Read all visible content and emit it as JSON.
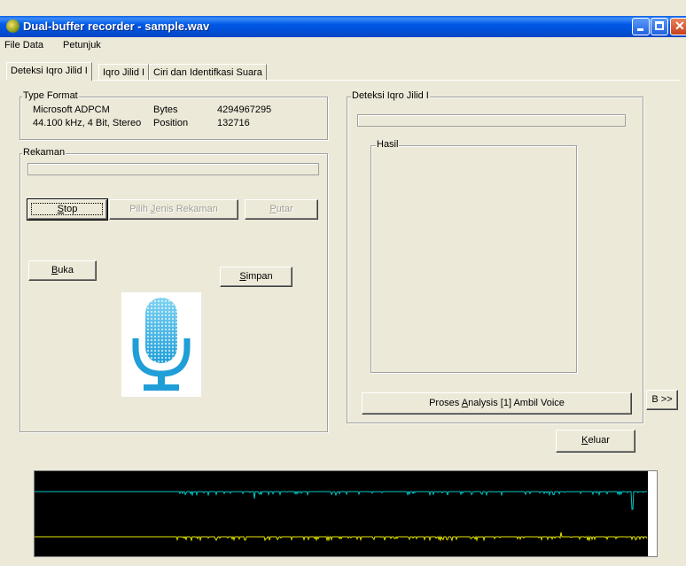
{
  "window": {
    "title": "Dual-buffer recorder - sample.wav"
  },
  "menu": {
    "items": [
      "File Data",
      "Petunjuk"
    ]
  },
  "tabs": [
    "Deteksi Iqro Jilid I",
    "Iqro Jilid I",
    "Ciri dan Identifkasi Suara"
  ],
  "type_format": {
    "label": "Type Format",
    "codec": "Microsoft ADPCM",
    "format": "44.100 kHz, 4 Bit, Stereo",
    "bytes_label": "Bytes",
    "bytes_value": "4294967295",
    "position_label": "Position",
    "position_value": "132716"
  },
  "rekaman": {
    "label": "Rekaman",
    "stop": {
      "accel": "S",
      "rest": "top"
    },
    "pilih": {
      "text": "Pilih ",
      "accel": "J",
      "rest": "enis Rekaman"
    },
    "putar": {
      "accel": "P",
      "rest": "utar"
    },
    "buka": {
      "accel": "B",
      "rest": "uka"
    },
    "simpan": {
      "accel": "S",
      "rest": "impan"
    }
  },
  "deteksi": {
    "label": "Deteksi Iqro Jilid I",
    "hasil_label": "Hasil",
    "proses": {
      "before": "Proses ",
      "accel": "A",
      "after": "nalysis [1] Ambil Voice"
    }
  },
  "side_button": "B >>",
  "keluar": {
    "accel": "K",
    "rest": "eluar"
  },
  "colors": {
    "wave_top": "#00c8c8",
    "wave_bottom": "#e6e600",
    "mic": "#1f9ed8"
  }
}
